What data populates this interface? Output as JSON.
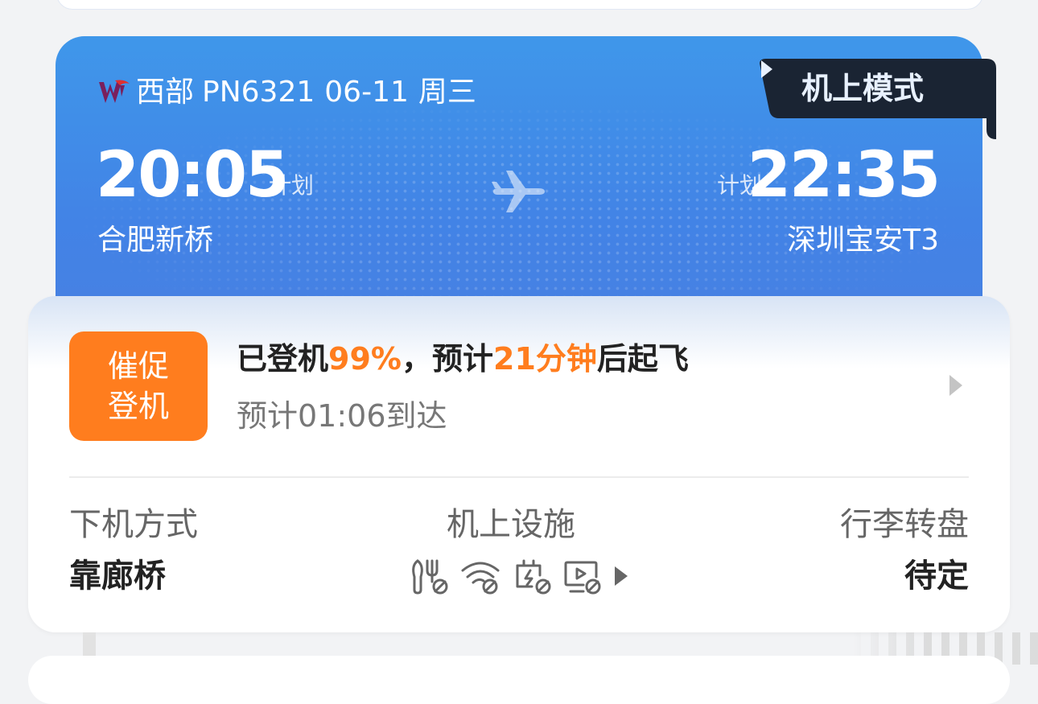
{
  "flight": {
    "airline_name": "西部",
    "flight_number": "PN6321",
    "date": "06-11",
    "weekday": "周三",
    "departure": {
      "time": "20:05",
      "tag": "计划",
      "airport": "合肥新桥"
    },
    "arrival": {
      "time": "22:35",
      "tag": "计划",
      "airport": "深圳宝安T3"
    },
    "mode_badge": "机上模式"
  },
  "status": {
    "urge_line1": "催促",
    "urge_line2": "登机",
    "boarding_prefix": "已登机",
    "boarding_percent": "99%",
    "mid_text": "，预计",
    "minutes": "21分钟",
    "suffix": "后起飞",
    "eta": "预计01:06到达"
  },
  "info": {
    "deplane_label": "下机方式",
    "deplane_value": "靠廊桥",
    "facility_label": "机上设施",
    "facility_icons": [
      "meal-unavailable-icon",
      "wifi-unavailable-icon",
      "power-unavailable-icon",
      "entertainment-unavailable-icon"
    ],
    "baggage_label": "行李转盘",
    "baggage_value": "待定"
  },
  "colors": {
    "card_blue": "#4283e6",
    "accent_orange": "#ff7d1e",
    "badge_dark": "#1a2433"
  }
}
